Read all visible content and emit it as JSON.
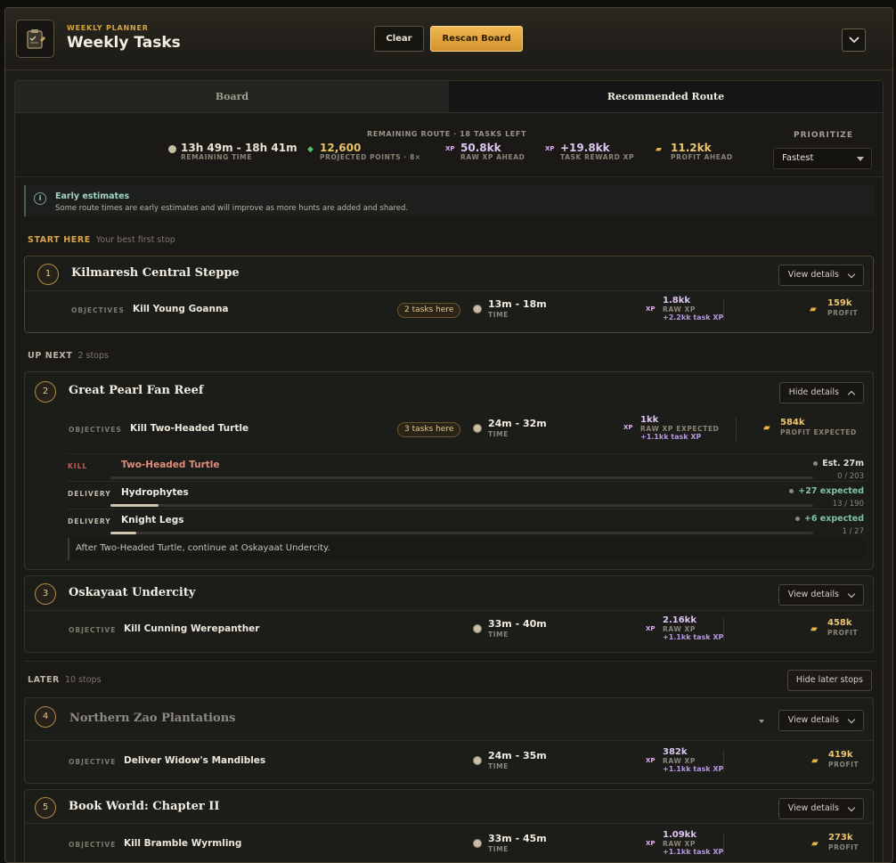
{
  "header": {
    "kicker": "WEEKLY PLANNER",
    "title": "Weekly Tasks",
    "clear_label": "Clear",
    "rescan_label": "Rescan Board"
  },
  "tabs": [
    {
      "label": "Board",
      "active": false
    },
    {
      "label": "Recommended Route",
      "active": true
    }
  ],
  "summary": {
    "title": "REMAINING ROUTE · 18 TASKS LEFT",
    "stats": [
      {
        "value": "13h 49m - 18h 41m",
        "label": "REMAINING TIME",
        "icon": "clock-icon"
      },
      {
        "value": "12,600",
        "label": "PROJECTED POINTS · 8×",
        "icon": "gem-icon",
        "color": "#e8c264"
      },
      {
        "value": "50.8kk",
        "label": "RAW XP AHEAD",
        "icon": "xp-icon",
        "color": "#dcc7f3"
      },
      {
        "value": "+19.8kk",
        "label": "TASK REWARD XP",
        "icon": "xp-icon",
        "color": "#dcc7f3"
      },
      {
        "value": "11.2kk",
        "label": "PROFIT AHEAD",
        "icon": "gold-icon",
        "color": "#ebc471"
      }
    ],
    "prioritize_label": "PRIORITIZE",
    "prioritize_value": "Fastest"
  },
  "info": {
    "title": "Early estimates",
    "text": "Some route times are early estimates and will improve as more hunts are added and shared."
  },
  "sections": {
    "start_label": "START HERE",
    "start_sub": "Your best first stop",
    "next_label": "UP NEXT",
    "next_sub": "2 stops",
    "later_label": "LATER",
    "later_sub": "10 stops",
    "later_button": "Hide later stops"
  },
  "stops": [
    {
      "num": "1",
      "name": "Kilmaresh Central Steppe",
      "button": "View details",
      "obj_label": "OBJECTIVES",
      "objective": "Kill Young Goanna",
      "tasks": "2 tasks here",
      "time": "13m - 18m",
      "time_label": "TIME",
      "xp": "1.8kk",
      "xp_label": "RAW XP",
      "xp_sub": "+2.2kk task XP",
      "profit": "159k",
      "profit_label": "PROFIT"
    },
    {
      "num": "2",
      "name": "Great Pearl Fan Reef",
      "button": "Hide details",
      "obj_label": "OBJECTIVES",
      "objective": "Kill Two-Headed Turtle",
      "tasks": "3 tasks here",
      "time": "24m - 32m",
      "time_label": "TIME",
      "xp": "1kk",
      "xp_label": "RAW XP EXPECTED",
      "xp_sub": "+1.1kk task XP",
      "profit": "584k",
      "profit_label": "PROFIT EXPECTED",
      "details": [
        {
          "type": "KILL",
          "name": "Two-Headed Turtle",
          "right": "Est. 27m",
          "count": "0 / 203",
          "progress": 0
        },
        {
          "type": "DELIVERY",
          "name": "Hydrophytes",
          "right": "+27 expected",
          "count": "13 / 190",
          "progress": 0.068
        },
        {
          "type": "DELIVERY",
          "name": "Knight Legs",
          "right": "+6 expected",
          "count": "1 / 27",
          "progress": 0.037
        }
      ],
      "note": "After Two-Headed Turtle, continue at Oskayaat Undercity."
    },
    {
      "num": "3",
      "name": "Oskayaat Undercity",
      "button": "View details",
      "obj_label": "OBJECTIVE",
      "objective": "Kill Cunning Werepanther",
      "time": "33m - 40m",
      "time_label": "TIME",
      "xp": "2.16kk",
      "xp_label": "RAW XP",
      "xp_sub": "+1.1kk task XP",
      "profit": "458k",
      "profit_label": "PROFIT"
    },
    {
      "num": "4",
      "name": "Northern Zao Plantations",
      "button": "View details",
      "obj_label": "OBJECTIVE",
      "objective": "Deliver Widow's Mandibles",
      "time": "24m - 35m",
      "time_label": "TIME",
      "xp": "382k",
      "xp_label": "RAW XP",
      "xp_sub": "+1.1kk task XP",
      "profit": "419k",
      "profit_label": "PROFIT"
    },
    {
      "num": "5",
      "name": "Book World: Chapter II",
      "button": "View details",
      "obj_label": "OBJECTIVE",
      "objective": "Kill Bramble Wyrmling",
      "time": "33m - 45m",
      "time_label": "TIME",
      "xp": "1.09kk",
      "xp_label": "RAW XP",
      "xp_sub": "+1.1kk task XP",
      "profit": "273k",
      "profit_label": "PROFIT"
    }
  ],
  "icons": {
    "xp": "XP",
    "gold": "💰"
  }
}
